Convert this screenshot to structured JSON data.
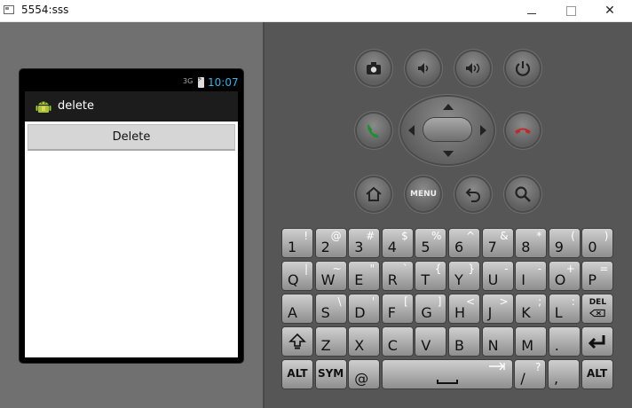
{
  "window": {
    "title": "5554:sss",
    "close_glyph": "✕"
  },
  "device": {
    "status": {
      "signal": "3G",
      "time": "10:07"
    },
    "app_title": "delete",
    "delete_button": "Delete"
  },
  "controls": {
    "menu_label": "MENU"
  },
  "colors": {
    "clock": "#33b5e5",
    "call_green": "#1e8f2e",
    "end_red": "#c22a2a"
  },
  "keyboard": {
    "rows": [
      [
        {
          "p": "1",
          "s": "!"
        },
        {
          "p": "2",
          "s": "@"
        },
        {
          "p": "3",
          "s": "#"
        },
        {
          "p": "4",
          "s": "$"
        },
        {
          "p": "5",
          "s": "%"
        },
        {
          "p": "6",
          "s": "^"
        },
        {
          "p": "7",
          "s": "&"
        },
        {
          "p": "8",
          "s": "*"
        },
        {
          "p": "9",
          "s": "("
        },
        {
          "p": "0",
          "s": ")"
        }
      ],
      [
        {
          "p": "Q",
          "s": "|"
        },
        {
          "p": "W",
          "s": "~"
        },
        {
          "p": "E",
          "s": "\""
        },
        {
          "p": "R",
          "s": "`"
        },
        {
          "p": "T",
          "s": "{"
        },
        {
          "p": "Y",
          "s": "}"
        },
        {
          "p": "U",
          "s": "-"
        },
        {
          "p": "I",
          "s": "-"
        },
        {
          "p": "O",
          "s": "+"
        },
        {
          "p": "P",
          "s": "="
        }
      ],
      [
        {
          "p": "A",
          "s": ""
        },
        {
          "p": "S",
          "s": "\\"
        },
        {
          "p": "D",
          "s": "'"
        },
        {
          "p": "F",
          "s": "["
        },
        {
          "p": "G",
          "s": "]"
        },
        {
          "p": "H",
          "s": "<"
        },
        {
          "p": "J",
          "s": ">"
        },
        {
          "p": "K",
          "s": ";"
        },
        {
          "p": "L",
          "s": ":"
        },
        {
          "c": "DEL"
        }
      ],
      [
        {
          "icon": "shift-icon"
        },
        {
          "p": "Z",
          "s": ""
        },
        {
          "p": "X",
          "s": ""
        },
        {
          "p": "C",
          "s": ""
        },
        {
          "p": "V",
          "s": ""
        },
        {
          "p": "B",
          "s": ""
        },
        {
          "p": "N",
          "s": ""
        },
        {
          "p": "M",
          "s": ""
        },
        {
          "p": ".",
          "s": ""
        },
        {
          "icon": "enter-icon"
        }
      ]
    ],
    "bottom": {
      "alt_left": "ALT",
      "sym": "SYM",
      "at": "@",
      "slash": "/",
      "slash_alt": "?",
      "comma": ",",
      "alt_right": "ALT"
    }
  }
}
